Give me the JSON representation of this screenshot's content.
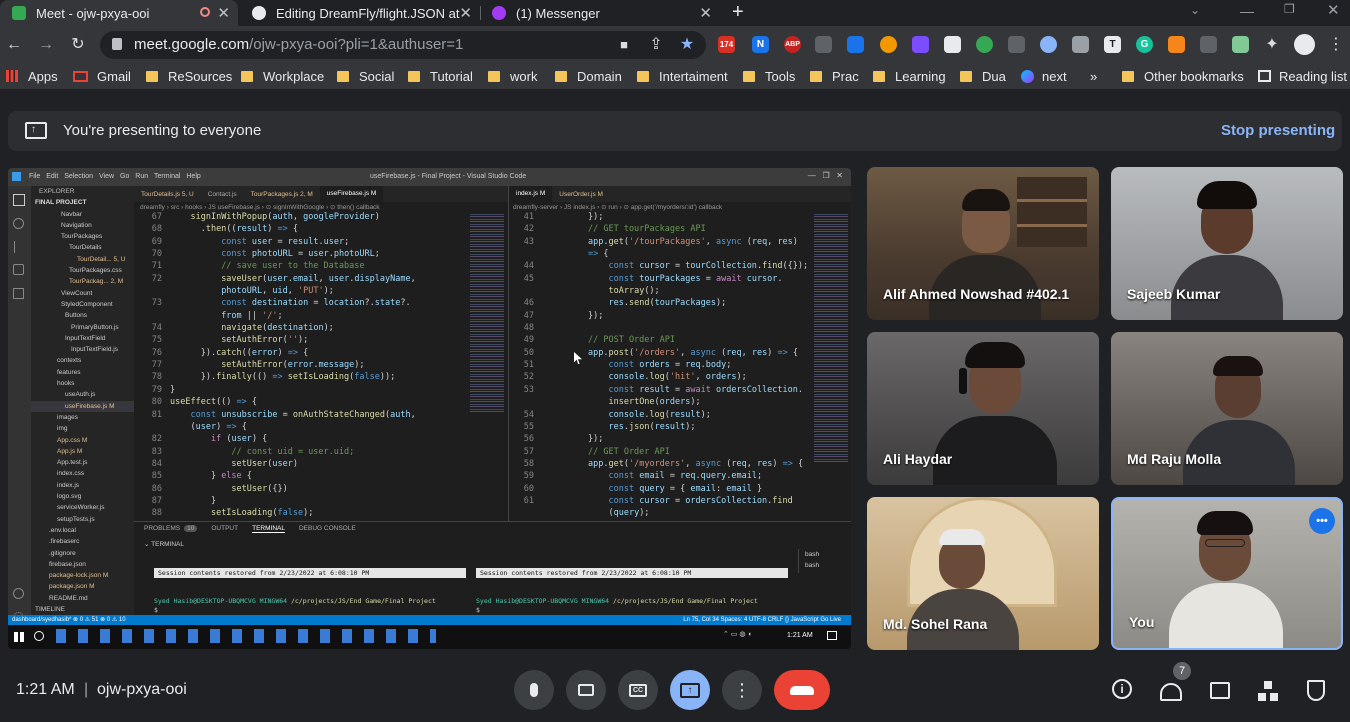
{
  "browser": {
    "tabs": [
      {
        "title": "Meet - ojw-pxya-ooi",
        "active": true,
        "color": "#34a853"
      },
      {
        "title": "Editing DreamFly/flight.JSON at",
        "active": false,
        "color": "#e8eaed"
      },
      {
        "title": "(1) Messenger",
        "active": false,
        "color": "#a33bf5"
      }
    ],
    "new_tab": "+",
    "close": "✕",
    "url_host": "meet.google.com",
    "url_path": "/ojw-pxya-ooi?pli=1&authuser=1",
    "extensions": [
      {
        "label": "174",
        "color": "#d93025"
      },
      {
        "label": "N",
        "color": "#1a73e8"
      },
      {
        "label": "ABP",
        "color": "#c5221f"
      }
    ],
    "bookmarks": [
      "Apps",
      "Gmail",
      "ReSources",
      "Workplace",
      "Social",
      "Tutorial",
      "work",
      "Domain",
      "Intertaiment",
      "Tools",
      "Prac",
      "Learning",
      "Dua",
      "next",
      "»",
      "Other bookmarks",
      "Reading list"
    ]
  },
  "banner": {
    "text": "You're presenting to everyone",
    "stop": "Stop presenting"
  },
  "screen": {
    "window_title": "useFirebase.js - Final Project - Visual Studio Code",
    "menu": [
      "File",
      "Edit",
      "Selection",
      "View",
      "Go",
      "Run",
      "Terminal",
      "Help"
    ],
    "explorer_title": "EXPLORER",
    "project": "FINAL PROJECT",
    "files": [
      "Navbar",
      "Navigation",
      "TourPackages",
      "TourDetails",
      "TourDetail... 5, U",
      "TourPackages.css",
      "TourPackag... 2, M",
      "ViewCount",
      "StyledComponent",
      "Buttons",
      "PrimaryButton.js",
      "InputTextField",
      "InputTextField.js",
      "contexts",
      "features",
      "hooks",
      "useAuth.js",
      "useFirebase.js  M",
      "images",
      "img",
      "App.css  M",
      "App.js  M",
      "App.test.js",
      "index.css",
      "index.js",
      "logo.svg",
      "serviceWorker.js",
      "setupTests.js",
      ".env.local",
      ".firebaserc",
      ".gitignore",
      "firebase.json",
      "package-lock.json  M",
      "package.json  M",
      "README.md",
      "TIMELINE"
    ],
    "left_tabs": [
      "TourDetails.js 5, U",
      "Contact.js",
      "TourPackages.js 2, M",
      "useFirebase.js M"
    ],
    "right_tabs": [
      "index.js M",
      "UserOrder.js M"
    ],
    "left_breadcrumb": "dreamfly › src › hooks › JS useFirebase.js › ⊙ signInWithGoogle › ⊙ then() callback",
    "right_breadcrumb": "dreamfly-server › JS index.js › ⊙ run › ⊙ app.get('/myorders/:id') callback",
    "left_lines": [
      "67",
      "68",
      "69",
      "70",
      "71",
      "72",
      "",
      "73",
      "",
      "74",
      "75",
      "76",
      "77",
      "78",
      "79",
      "80",
      "81",
      "",
      "82",
      "83",
      "84",
      "85",
      "86",
      "87",
      "88"
    ],
    "right_lines": [
      "41",
      "42",
      "43",
      "",
      "44",
      "45",
      "",
      "46",
      "47",
      "48",
      "49",
      "50",
      "51",
      "52",
      "53",
      "",
      "54",
      "55",
      "56",
      "57",
      "58",
      "59",
      "60",
      "61",
      ""
    ],
    "panel_tabs": [
      "PROBLEMS",
      "10",
      "OUTPUT",
      "TERMINAL",
      "DEBUG CONSOLE"
    ],
    "terminal_label": "TERMINAL",
    "session_text": "Session contents restored from 2/23/2022 at 6:08:10 PM",
    "prompt_user": "Syed Hasib@DESKTOP-UBQMCVG MINGW64",
    "prompt_path": "/c/projects/JS/End Game/Final Project",
    "prompt_char": "$",
    "bash_items": [
      "bash",
      "bash"
    ],
    "status_left": "dashboard/syedhasib*   ⊗ 0 ⚠ 51   ⊗ 0 ⚠ 10",
    "status_right": "Ln 75, Col 34   Spaces: 4   UTF-8   CRLF   {} JavaScript   Go Live",
    "taskbar_time": "1:21 AM"
  },
  "participants": [
    {
      "name": "Alif Ahmed Nowshad #402.1",
      "bg": "#5a4a3a"
    },
    {
      "name": "Sajeeb Kumar",
      "bg": "#8a8c8e"
    },
    {
      "name": "Ali Haydar",
      "bg": "#4a4a4a"
    },
    {
      "name": "Md Raju Molla",
      "bg": "#5b5550"
    },
    {
      "name": "Md. Sohel Rana",
      "bg": "#c9b089"
    },
    {
      "name": "You",
      "bg": "#9a9a95",
      "more": "•••"
    }
  ],
  "bottom": {
    "time": "1:21 AM",
    "separator": "|",
    "meeting_code": "ojw-pxya-ooi",
    "people_count": "7"
  },
  "colors": {
    "accent": "#8ab4f8",
    "end_call": "#ea4335",
    "presenting": "#8ab4f8",
    "highlight_border": "#8ab4f8"
  }
}
